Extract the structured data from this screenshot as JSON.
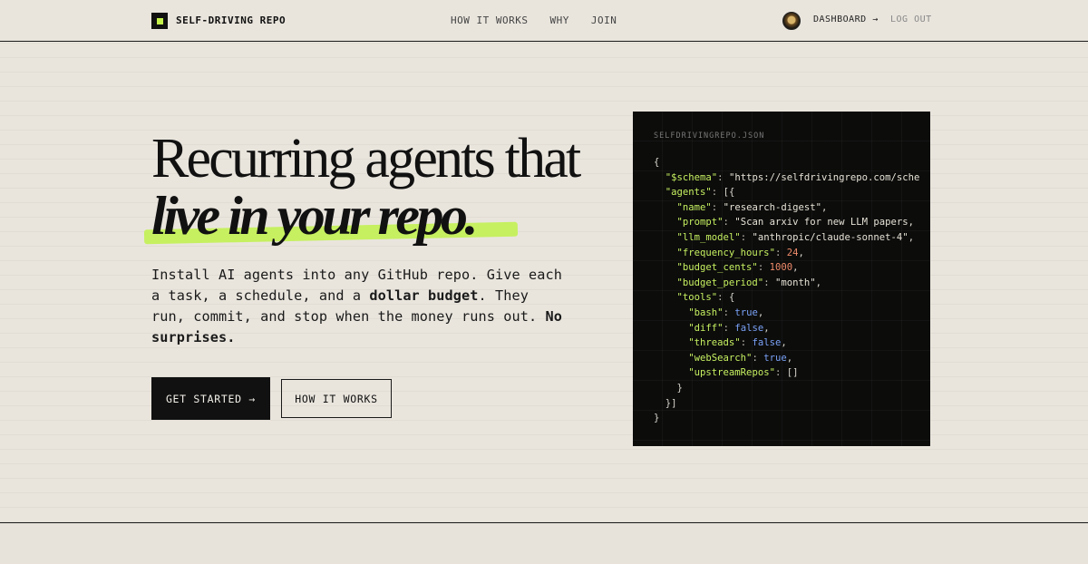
{
  "nav": {
    "brand": "SELF-DRIVING REPO",
    "links": [
      "HOW IT WORKS",
      "WHY",
      "JOIN"
    ],
    "dashboard": "DASHBOARD →",
    "logout": "LOG OUT"
  },
  "hero": {
    "line1": "Recurring agents that",
    "line2": "live in your repo.",
    "lead_parts": [
      "Install AI agents into any GitHub repo. Give each a task, a schedule, and a ",
      "dollar budget",
      ". They run, commit, and stop when the money runs out. ",
      "No surprises."
    ],
    "cta_primary": "GET STARTED →",
    "cta_secondary": "HOW IT WORKS"
  },
  "code": {
    "title": "SELFDRIVINGREPO.JSON",
    "lines": [
      "{",
      "  \"$schema\": \"https://selfdrivingrepo.com/sche",
      "  \"agents\": [{",
      "    \"name\": \"research-digest\",",
      "    \"prompt\": \"Scan arxiv for new LLM papers,",
      "    \"llm_model\": \"anthropic/claude-sonnet-4\",",
      "    \"frequency_hours\": 24,",
      "    \"budget_cents\": 1000,",
      "    \"budget_period\": \"month\",",
      "    \"tools\": {",
      "      \"bash\": true,",
      "      \"diff\": false,",
      "      \"threads\": false,",
      "      \"webSearch\": true,",
      "      \"upstreamRepos\": []",
      "    }",
      "  }]",
      "}"
    ]
  },
  "colors": {
    "accent": "#c6f060",
    "background": "#e9e5dd",
    "ink": "#111111",
    "code_bg": "#0c0c0b"
  }
}
